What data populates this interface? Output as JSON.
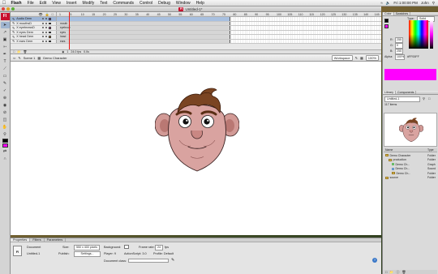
{
  "menubar": {
    "app": "Flash",
    "items": [
      "File",
      "Edit",
      "View",
      "Insert",
      "Modify",
      "Text",
      "Commands",
      "Control",
      "Debug",
      "Window",
      "Help"
    ],
    "clock": "Fri 1:00:00 PM",
    "user": "John"
  },
  "window": {
    "title": "Untitled-1*",
    "badge": "Fl"
  },
  "toolbar": {
    "logo": "Fl",
    "tools": [
      "arrow-tool",
      "subselect-tool",
      "transform-tool",
      "lasso-tool",
      "pen-tool",
      "text-tool",
      "line-tool",
      "rectangle-tool",
      "pencil-tool",
      "brush-tool",
      "bone-tool",
      "paint-bucket-tool",
      "eyedropper-tool",
      "eraser-tool",
      "hand-tool",
      "zoom-tool"
    ],
    "stroke_color": "#000000",
    "fill_color": "#ff00ff"
  },
  "timeline": {
    "ruler": [
      "1",
      "5",
      "10",
      "15",
      "20",
      "25",
      "30",
      "35",
      "40",
      "45",
      "50",
      "55",
      "60",
      "65",
      "70",
      "75",
      "80",
      "85",
      "90",
      "95",
      "100",
      "105",
      "110",
      "115",
      "120",
      "125",
      "130",
      "135",
      "140",
      "145"
    ],
    "layers": [
      {
        "name": "Audio Dem",
        "frame_label": "",
        "selected": true,
        "color": "#b04fff"
      },
      {
        "name": "X mouthsD",
        "frame_label": "mouth",
        "selected": false,
        "color": "#5aa1ff"
      },
      {
        "name": "X eyebrowsD",
        "frame_label": "eyebrow",
        "selected": false,
        "color": "#ff5ad0"
      },
      {
        "name": "X eyes Dem",
        "frame_label": "eyes",
        "selected": false,
        "color": "#3cd26a"
      },
      {
        "name": "X head Dem",
        "frame_label": "head",
        "selected": false,
        "color": "#ffb347"
      },
      {
        "name": "X ears Dem",
        "frame_label": "ears",
        "selected": false,
        "color": "#5aa1ff"
      }
    ],
    "footer": {
      "frame": "1",
      "fps": "24.0 fps",
      "time": "0.0s"
    }
  },
  "editbar": {
    "back": "⇦",
    "scene": "Scene 1",
    "symbol": "Demo Character",
    "workspace": "Workspace",
    "zoom": "100%"
  },
  "properties": {
    "tabs": [
      "Properties",
      "Filters",
      "Parameters"
    ],
    "doc_type": "Document",
    "doc_name": "Untitled-1",
    "size_label": "Size:",
    "size_value": "550 x 400 pixels",
    "publish_label": "Publish:",
    "settings_button": "Settings...",
    "background_label": "Background:",
    "framerate_label": "Frame rate:",
    "framerate_value": "24",
    "fps_unit": "fps",
    "player_label": "Player: 9",
    "actionscript_label": "ActionScript: 3.0",
    "profile_label": "Profile: Default",
    "doc_class_label": "Document class:"
  },
  "color_panel": {
    "tabs": [
      "Color",
      "Swatches"
    ],
    "type_label": "Type:",
    "type_value": "Solid",
    "r_label": "R:",
    "r_value": "255",
    "g_label": "G:",
    "g_value": "0",
    "b_label": "B:",
    "b_value": "255",
    "alpha_label": "Alpha:",
    "alpha_value": "100%",
    "hex": "#FF00FF",
    "swatch_color": "#ff00ff"
  },
  "library_panel": {
    "tabs": [
      "Library",
      "Components"
    ],
    "document": "Untitled-1",
    "item_count": "117 items",
    "col_name": "Name",
    "col_type": "Type",
    "items": [
      {
        "name": "Demo Character",
        "type": "Folder",
        "icon": "folder-icon",
        "indent": 0
      },
      {
        "name": "production",
        "type": "Folder",
        "icon": "folder-icon",
        "indent": 1
      },
      {
        "name": "Demo Ch...",
        "type": "Graph",
        "icon": "graphic-icon",
        "indent": 2
      },
      {
        "name": "Demo Ch...",
        "type": "Sound",
        "icon": "sound-icon",
        "indent": 2
      },
      {
        "name": "Demo Ch...",
        "type": "Folder",
        "icon": "folder-icon",
        "indent": 2
      },
      {
        "name": "source",
        "type": "Folder",
        "icon": "folder-icon",
        "indent": 0
      }
    ]
  }
}
